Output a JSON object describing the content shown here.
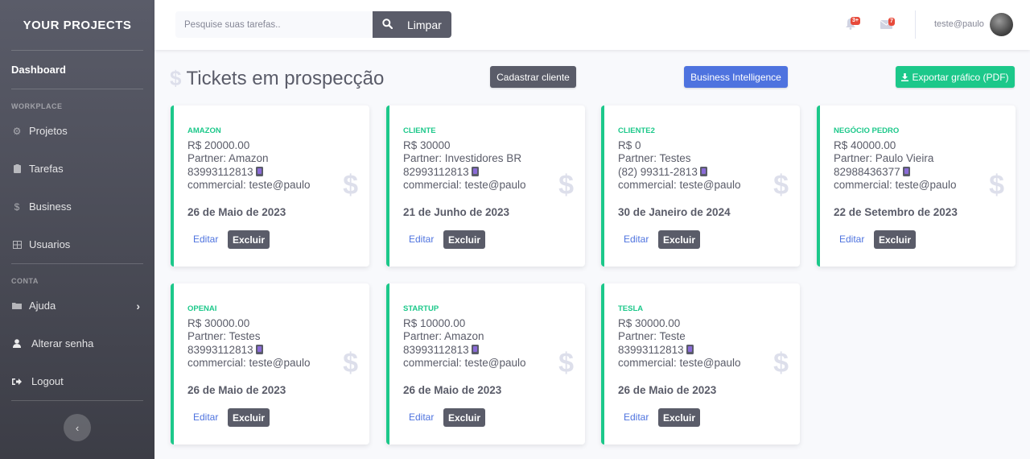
{
  "sidebar": {
    "brand": "YOUR PROJECTS",
    "dashboard": "Dashboard",
    "section_workplace": "WORKPLACE",
    "section_conta": "CONTA",
    "items": [
      {
        "label": "Projetos",
        "icon": "gear-icon"
      },
      {
        "label": "Tarefas",
        "icon": "clipboard-icon"
      },
      {
        "label": "Business",
        "icon": "dollar-icon"
      },
      {
        "label": "Usuarios",
        "icon": "table-icon"
      }
    ],
    "account_items": [
      {
        "label": "Ajuda",
        "icon": "folder-icon"
      },
      {
        "label": "Alterar senha",
        "icon": "user-icon"
      },
      {
        "label": "Logout",
        "icon": "sign-out-icon"
      }
    ],
    "toggle_glyph": "‹"
  },
  "topbar": {
    "search_placeholder": "Pesquise suas tarefas..",
    "search_button": "Limpar",
    "alerts_badge": "3+",
    "messages_badge": "7",
    "username": "teste@paulo"
  },
  "header": {
    "title": "Tickets em prospecção",
    "btn_cadastrar": "Cadastrar cliente",
    "btn_bi": "Business Intelligence",
    "btn_export": "Exportar gráfico (PDF)",
    "export_icon": "download-icon"
  },
  "colors": {
    "accent_green": "#1cc88a",
    "primary_blue": "#4e73df",
    "dark_gray": "#5a5c69",
    "danger_red": "#e74a3b"
  },
  "cards": [
    {
      "name": "AMAZON",
      "value": "R$ 20000.00",
      "partner": "Partner: Amazon",
      "phone": "83993112813",
      "commercial": "commercial: teste@paulo",
      "date": "26 de Maio de 2023",
      "edit": "Editar",
      "delete": "Excluir"
    },
    {
      "name": "CLIENTE",
      "value": "R$ 30000",
      "partner": "Partner: Investidores BR",
      "phone": "82993112813",
      "commercial": "commercial: teste@paulo",
      "date": "21 de Junho de 2023",
      "edit": "Editar",
      "delete": "Excluir"
    },
    {
      "name": "CLIENTE2",
      "value": "R$ 0",
      "partner": "Partner: Testes",
      "phone": "(82) 99311-2813",
      "commercial": "commercial: teste@paulo",
      "date": "30 de Janeiro de 2024",
      "edit": "Editar",
      "delete": "Excluir"
    },
    {
      "name": "NEGÓCIO PEDRO",
      "value": "R$ 40000.00",
      "partner": "Partner: Paulo Vieira",
      "phone": "82988436377",
      "commercial": "commercial: teste@paulo",
      "date": "22 de Setembro de 2023",
      "edit": "Editar",
      "delete": "Excluir"
    },
    {
      "name": "OPENAI",
      "value": "R$ 30000.00",
      "partner": "Partner: Testes",
      "phone": "83993112813",
      "commercial": "commercial: teste@paulo",
      "date": "26 de Maio de 2023",
      "edit": "Editar",
      "delete": "Excluir"
    },
    {
      "name": "STARTUP",
      "value": "R$ 10000.00",
      "partner": "Partner: Amazon",
      "phone": "83993112813",
      "commercial": "commercial: teste@paulo",
      "date": "26 de Maio de 2023",
      "edit": "Editar",
      "delete": "Excluir"
    },
    {
      "name": "TESLA",
      "value": "R$ 30000.00",
      "partner": "Partner: Teste",
      "phone": "83993112813",
      "commercial": "commercial: teste@paulo",
      "date": "26 de Maio de 2023",
      "edit": "Editar",
      "delete": "Excluir"
    }
  ]
}
